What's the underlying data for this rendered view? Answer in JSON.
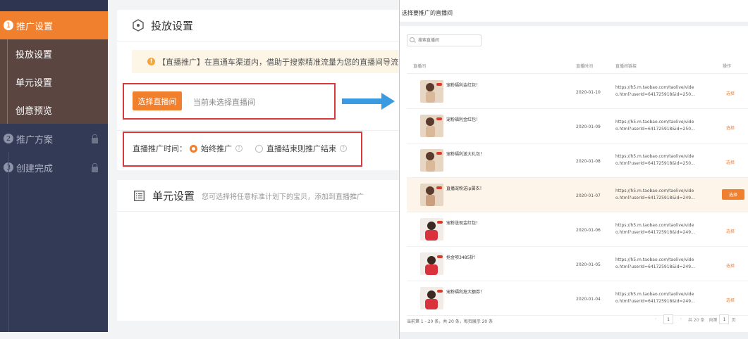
{
  "sidebar": {
    "steps": [
      {
        "num": "1",
        "label": "推广设置"
      },
      {
        "num": "2",
        "label": "推广方案"
      },
      {
        "num": "3",
        "label": "创建完成"
      }
    ],
    "sub_items": [
      "投放设置",
      "单元设置",
      "创意预览"
    ]
  },
  "delivery": {
    "title": "投放设置",
    "notice": "【直播推广】在直通车渠道内，借助于搜索精准流量为您的直播间导流，进",
    "select_button": "选择直播间",
    "no_selection": "当前未选择直播间",
    "time_label": "直播推广时间：",
    "options": [
      "始终推广",
      "直播结束则推广结束"
    ]
  },
  "unit": {
    "title": "单元设置",
    "hint": "您可选择将任意标准计划下的宝贝，添加到直播推广"
  },
  "picker": {
    "title": "选择要推广的直播间",
    "search_placeholder": "搜索直播间",
    "columns": [
      "直播间",
      "直播时间",
      "直播间链接",
      "操作"
    ],
    "rows": [
      {
        "name": "宠粉福利金红包！",
        "date": "2020-01-10",
        "link1": "https://h5.m.taobao.com/taolive/vide",
        "link2": "o.html?userId=641725918&id=250...",
        "action": "选择"
      },
      {
        "name": "宠粉福利金红包！",
        "date": "2020-01-09",
        "link1": "https://h5.m.taobao.com/taolive/vide",
        "link2": "o.html?userId=641725918&id=250...",
        "action": "选择"
      },
      {
        "name": "宠粉福利送大礼包！",
        "date": "2020-01-08",
        "link1": "https://h5.m.taobao.com/taolive/vide",
        "link2": "o.html?userId=641725918&id=250...",
        "action": "选择"
      },
      {
        "name": "直播宠粉送ip属衣！",
        "date": "2020-01-07",
        "link1": "https://h5.m.taobao.com/taolive/vide",
        "link2": "o.html?userId=641725918&id=249...",
        "action": "选择"
      },
      {
        "name": "宠粉送现金红包！",
        "date": "2020-01-06",
        "link1": "https://h5.m.taobao.com/taolive/vide",
        "link2": "o.html?userId=641725918&id=249...",
        "action": "选择"
      },
      {
        "name": "抢金项3485折！",
        "date": "2020-01-05",
        "link1": "https://h5.m.taobao.com/taolive/vide",
        "link2": "o.html?userId=641725918&id=249...",
        "action": "选择"
      },
      {
        "name": "宠粉福利抢大额券！",
        "date": "2020-01-04",
        "link1": "https://h5.m.taobao.com/taolive/vide",
        "link2": "o.html?userId=641725918&id=249...",
        "action": "选择"
      }
    ],
    "footer": "当前第 1 - 20 条，共 20 条，每页展示 20 条",
    "pager": {
      "current": "1",
      "total": "共 20 条",
      "goto_label": "向第",
      "goto_value": "1",
      "page_unit": "页"
    }
  },
  "colors": {
    "accent": "#f07f2e",
    "sidebar": "#333a55",
    "sub_item": "#5a4540",
    "alert_box": "#d9393c",
    "arrow": "#3a9be0"
  }
}
